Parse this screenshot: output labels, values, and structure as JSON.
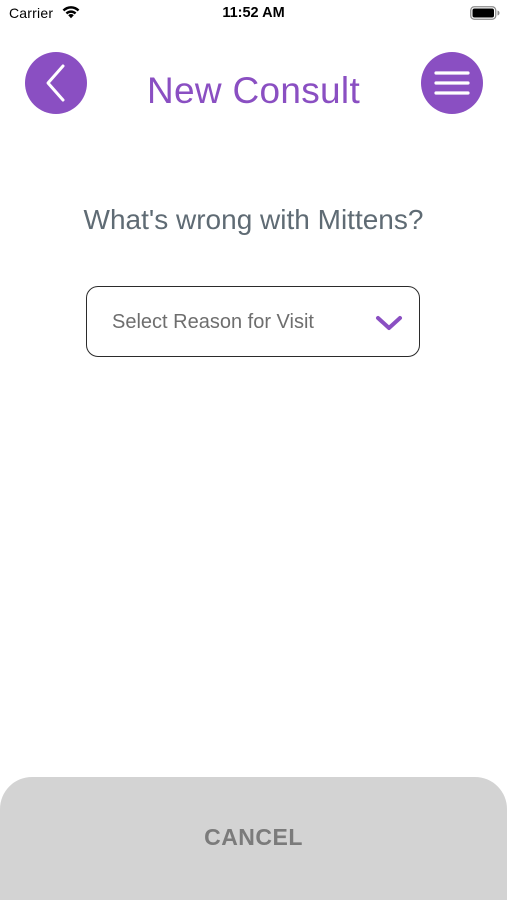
{
  "status_bar": {
    "carrier": "Carrier",
    "time": "11:52 AM",
    "wifi_icon": "wifi-icon",
    "battery_icon": "battery-icon"
  },
  "header": {
    "title": "New Consult",
    "back_icon": "chevron-left-icon",
    "menu_icon": "hamburger-menu-icon"
  },
  "main": {
    "question": "What's wrong with Mittens?",
    "reason_select": {
      "placeholder": "Select Reason for Visit",
      "icon": "chevron-down-icon"
    }
  },
  "footer": {
    "cancel_label": "CANCEL"
  },
  "colors": {
    "accent": "#8a4fc2",
    "question_text": "#5f6b74",
    "footer_background": "#d3d3d3",
    "footer_text": "#7b7b7b"
  }
}
